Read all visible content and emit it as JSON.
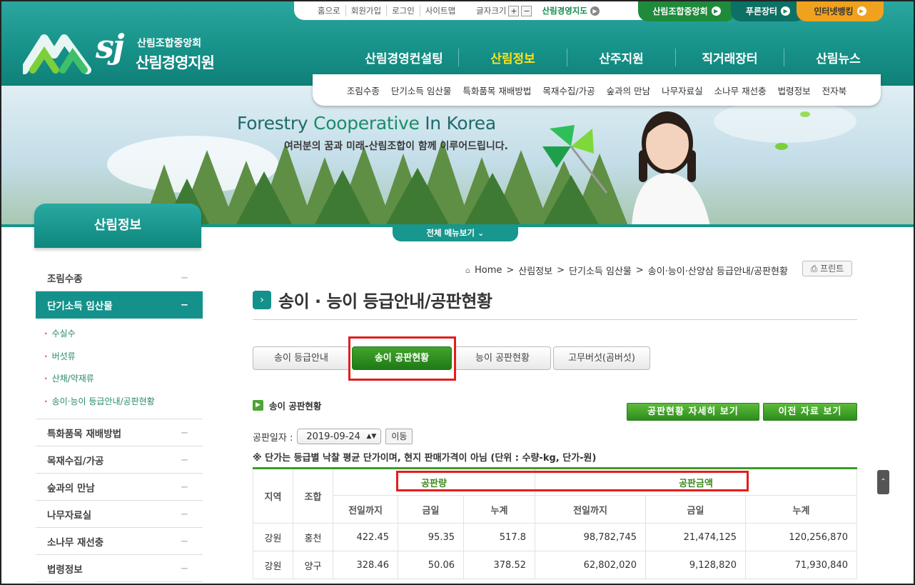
{
  "util": {
    "links": [
      "홈으로",
      "회원가입",
      "로그인",
      "사이트맵"
    ],
    "font_size_label": "글자크기",
    "font_plus": "+",
    "font_minus": "−",
    "map_label": "산림경영지도",
    "pills": [
      "산림조합중앙회",
      "푸른장터",
      "인터넷뱅킹"
    ]
  },
  "logo": {
    "mark": "sj",
    "line1": "산림조합중앙회",
    "line2": "산림경영지원"
  },
  "gnb": {
    "items": [
      "산림경영컨설팅",
      "산림정보",
      "산주지원",
      "직거래장터",
      "산림뉴스"
    ],
    "active_index": 1
  },
  "subnav": [
    "조림수종",
    "단기소득 임산물",
    "특화품목 재배방법",
    "목재수집/가공",
    "숲과의 만남",
    "나무자료실",
    "소나무 재선충",
    "법령정보",
    "전자북"
  ],
  "banner": {
    "title_a": "Forestry ",
    "title_b": "Cooperative",
    "title_c": " In Korea",
    "subtitle": "여러분의 꿈과 미래-산림조합이 함께 이루어드립니다."
  },
  "menu_all_label": "전체 메뉴보기",
  "side": {
    "head": "산림정보",
    "items": [
      {
        "label": "조림수종",
        "mark": "−"
      },
      {
        "label": "단기소득 임산물",
        "mark": "−"
      },
      {
        "label": "특화품목 재배방법",
        "mark": "−"
      },
      {
        "label": "목재수집/가공",
        "mark": "−"
      },
      {
        "label": "숲과의 만남",
        "mark": "−"
      },
      {
        "label": "나무자료실",
        "mark": "−"
      },
      {
        "label": "소나무 재선충",
        "mark": "−"
      },
      {
        "label": "법령정보",
        "mark": "−"
      }
    ],
    "subs": [
      "수실수",
      "버섯류",
      "산채/약재류",
      "송이·능이 등급안내/공판현황"
    ]
  },
  "breadcrumb": [
    "Home",
    "산림정보",
    "단기소득 임산물",
    "송이·능이·산양삼 등급안내/공판현황"
  ],
  "print_label": "프린트",
  "page_title": "송이 · 능이 등급안내/공판현황",
  "tabs": [
    "송이 등급안내",
    "송이 공판현황",
    "능이 공판현황",
    "고무버섯(곰버섯)"
  ],
  "section_title": "송이 공판현황",
  "buttons": {
    "detail": "공판현황 자세히 보기",
    "prev": "이전 자료 보기"
  },
  "date": {
    "label": "공판일자 :",
    "value": "2019-09-24",
    "move": "이동"
  },
  "note": "※ 단가는 등급별 낙찰 평균 단가이며, 현지 판매가격이 아님 (단위 : 수량-kg, 단가-원)",
  "table": {
    "h_region": "지역",
    "h_coop": "조합",
    "h_qty": "공판량",
    "h_amt": "공판금액",
    "sub": [
      "전일까지",
      "금일",
      "누계",
      "전일까지",
      "금일",
      "누계"
    ],
    "rows": [
      [
        "강원",
        "홍천",
        "422.45",
        "95.35",
        "517.8",
        "98,782,745",
        "21,474,125",
        "120,256,870"
      ],
      [
        "강원",
        "양구",
        "328.46",
        "50.06",
        "378.52",
        "62,802,020",
        "9,128,820",
        "71,930,840"
      ]
    ]
  }
}
